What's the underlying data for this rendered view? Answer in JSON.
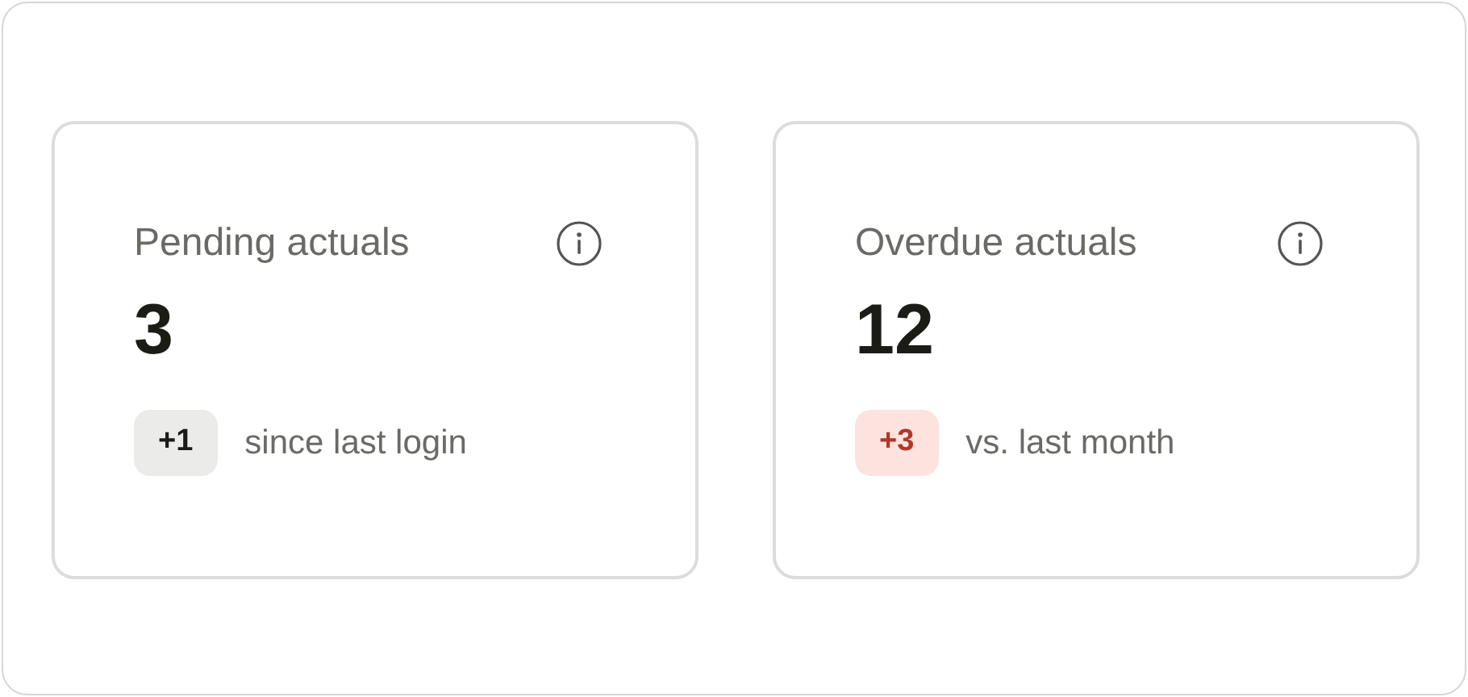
{
  "cards": [
    {
      "title": "Pending actuals",
      "value": "3",
      "badge": {
        "text": "+1",
        "kind": "neutral"
      },
      "note": "since last login"
    },
    {
      "title": "Overdue actuals",
      "value": "12",
      "badge": {
        "text": "+3",
        "kind": "negative"
      },
      "note": "vs. last month"
    }
  ]
}
